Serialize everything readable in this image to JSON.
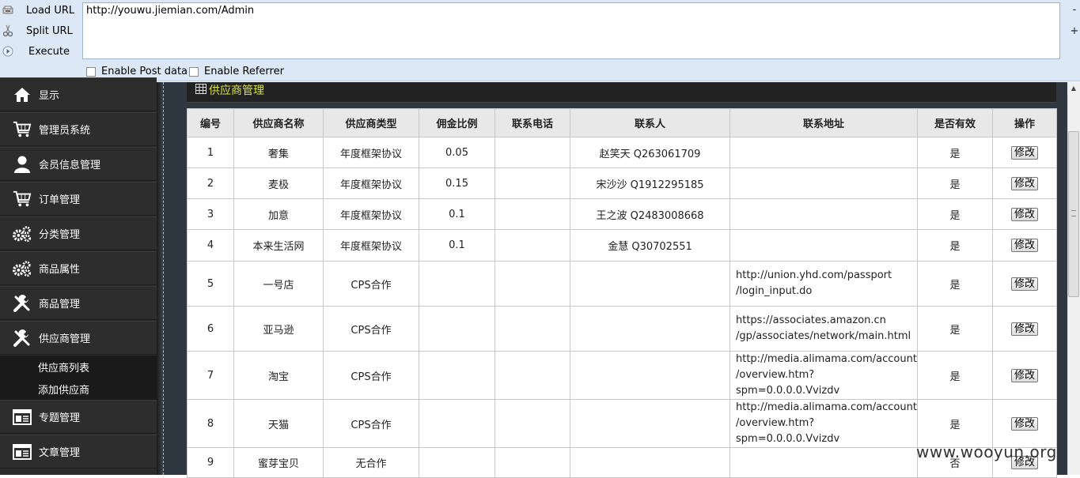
{
  "hackbar": {
    "buttons": [
      {
        "label": "Load URL",
        "icon": "load-url-icon"
      },
      {
        "label": "Split URL",
        "icon": "scissors-icon"
      },
      {
        "label": "Execute",
        "icon": "play-icon"
      }
    ],
    "url": "http://youwu.jiemian.com/Admin",
    "minus": "-",
    "plus": "+",
    "enable_post": "Enable Post data",
    "enable_referrer": "Enable Referrer"
  },
  "sidebar": {
    "items": [
      {
        "label": "显示",
        "icon": "home-icon"
      },
      {
        "label": "管理员系统",
        "icon": "cart-icon"
      },
      {
        "label": "会员信息管理",
        "icon": "user-icon"
      },
      {
        "label": "订单管理",
        "icon": "cart-icon"
      },
      {
        "label": "分类管理",
        "icon": "gears-icon"
      },
      {
        "label": "商品属性",
        "icon": "gears-icon"
      },
      {
        "label": "商品管理",
        "icon": "wrench-icon"
      },
      {
        "label": "供应商管理",
        "icon": "wrench-icon"
      },
      {
        "label": "专题管理",
        "icon": "window-icon"
      },
      {
        "label": "文章管理",
        "icon": "window-icon"
      }
    ],
    "subitems": [
      "供应商列表",
      "添加供应商"
    ]
  },
  "panel": {
    "title": "供应商管理"
  },
  "table": {
    "headers": [
      "编号",
      "供应商名称",
      "供应商类型",
      "佣金比例",
      "联系电话",
      "联系人",
      "联系地址",
      "是否有效",
      "操作"
    ],
    "rows": [
      {
        "id": "1",
        "name": "奢集",
        "type": "年度框架协议",
        "rate": "0.05",
        "phone": "",
        "contact": "赵笑天 Q263061709",
        "addr1": "",
        "addr2": "",
        "valid": "是",
        "action": "修改"
      },
      {
        "id": "2",
        "name": "麦极",
        "type": "年度框架协议",
        "rate": "0.15",
        "phone": "",
        "contact": "宋沙沙 Q1912295185",
        "addr1": "",
        "addr2": "",
        "valid": "是",
        "action": "修改"
      },
      {
        "id": "3",
        "name": "加意",
        "type": "年度框架协议",
        "rate": "0.1",
        "phone": "",
        "contact": "王之波 Q2483008668",
        "addr1": "",
        "addr2": "",
        "valid": "是",
        "action": "修改"
      },
      {
        "id": "4",
        "name": "本来生活网",
        "type": "年度框架协议",
        "rate": "0.1",
        "phone": "",
        "contact": "金慧 Q30702551",
        "addr1": "",
        "addr2": "",
        "valid": "是",
        "action": "修改"
      },
      {
        "id": "5",
        "name": "一号店",
        "type": "CPS合作",
        "rate": "",
        "phone": "",
        "contact": "",
        "addr1": "http://union.yhd.com/passport",
        "addr2": "/login_input.do",
        "valid": "是",
        "action": "修改"
      },
      {
        "id": "6",
        "name": "亚马逊",
        "type": "CPS合作",
        "rate": "",
        "phone": "",
        "contact": "",
        "addr1": "https://associates.amazon.cn",
        "addr2": "/gp/associates/network/main.html",
        "valid": "是",
        "action": "修改"
      },
      {
        "id": "7",
        "name": "淘宝",
        "type": "CPS合作",
        "rate": "",
        "phone": "",
        "contact": "",
        "addr1": "http://media.alimama.com/account",
        "addr2": "/overview.htm?spm=0.0.0.0.Vvizdv",
        "valid": "是",
        "action": "修改"
      },
      {
        "id": "8",
        "name": "天猫",
        "type": "CPS合作",
        "rate": "",
        "phone": "",
        "contact": "",
        "addr1": "http://media.alimama.com/account",
        "addr2": "/overview.htm?spm=0.0.0.0.Vvizdv",
        "valid": "是",
        "action": "修改"
      },
      {
        "id": "9",
        "name": "蜜芽宝贝",
        "type": "无合作",
        "rate": "",
        "phone": "",
        "contact": "",
        "addr1": "",
        "addr2": "",
        "valid": "否",
        "action": "修改"
      }
    ]
  },
  "watermark": "www.wooyun.org"
}
